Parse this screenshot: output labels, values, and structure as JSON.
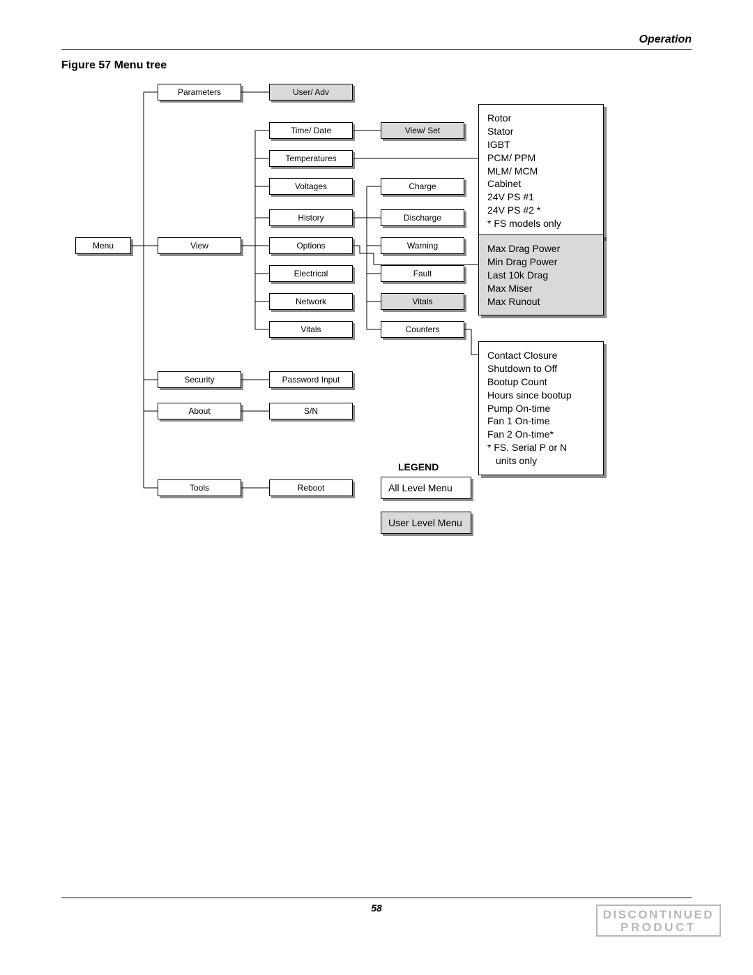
{
  "page": {
    "section": "Operation",
    "figure_title": "Figure 57  Menu tree",
    "page_number": "58",
    "stamp_line1": "DISCONTINUED",
    "stamp_line2": "PRODUCT"
  },
  "legend": {
    "title": "LEGEND",
    "all_level": "All Level Menu",
    "user_level": "User Level Menu"
  },
  "nodes": {
    "menu": "Menu",
    "parameters": "Parameters",
    "view": "View",
    "security": "Security",
    "about": "About",
    "tools": "Tools",
    "user_adv": "User/ Adv",
    "time_date": "Time/ Date",
    "temperatures": "Temperatures",
    "voltages": "Voltages",
    "history": "History",
    "options": "Options",
    "electrical": "Electrical",
    "network": "Network",
    "vitals_view": "Vitals",
    "password_input": "Password Input",
    "sn": "S/N",
    "reboot": "Reboot",
    "view_set": "View/ Set",
    "charge": "Charge",
    "discharge": "Discharge",
    "warning": "Warning",
    "fault": "Fault",
    "vitals_hist": "Vitals",
    "counters": "Counters"
  },
  "panels": {
    "temps": [
      "Rotor",
      "Stator",
      "IGBT",
      "PCM/ PPM",
      "MLM/ MCM",
      "Cabinet",
      "24V PS #1",
      "24V PS #2 *",
      "*  FS models only"
    ],
    "options": [
      "Max Drag Power",
      "Min Drag Power",
      "Last 10k Drag",
      "Max Miser",
      "Max Runout"
    ],
    "counters": [
      "Contact Closure",
      "Shutdown to Off",
      "Bootup Count",
      "Hours since bootup",
      "Pump On-time",
      "Fan 1 On-time",
      "Fan 2 On-time*",
      "*  FS, Serial P or N",
      "   units only"
    ]
  }
}
